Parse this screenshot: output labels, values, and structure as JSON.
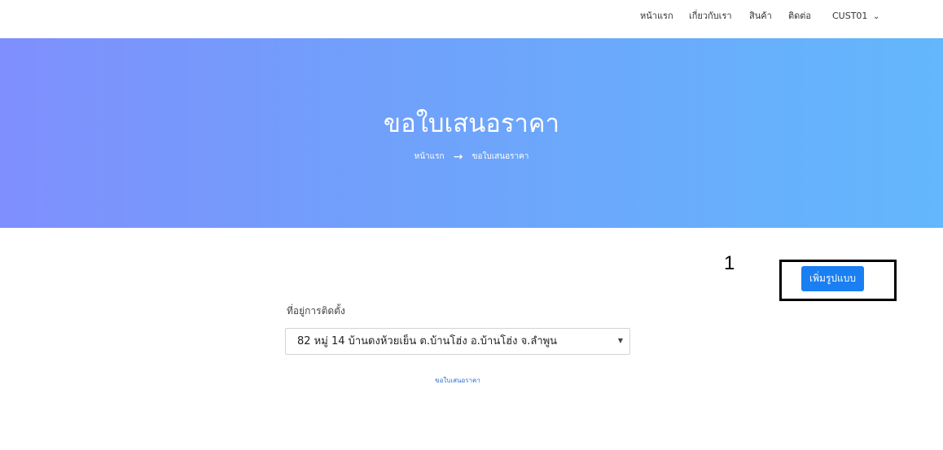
{
  "nav": {
    "home": "หน้าแรก",
    "about": "เกี่ยวกับเรา",
    "products": "สินค้า",
    "contact": "ติดต่อ",
    "user": "CUST01",
    "user_caret": "⌄"
  },
  "hero": {
    "title": "ขอใบเสนอราคา",
    "breadcrumb": {
      "home": "หน้าแรก",
      "arrow": "→",
      "current": "ขอใบเสนอราคา"
    }
  },
  "annotation": {
    "marker": "1"
  },
  "actions": {
    "add_pattern": "เพิ่มรูปแบบ"
  },
  "form": {
    "address_label": "ที่อยู่การติดตั้ง",
    "address_value": "82 หมู่ 14 บ้านดงห้วยเย็น ต.บ้านโฮ่ง อ.บ้านโฮ่ง จ.ลำพูน",
    "caret": "▼",
    "submit_link": "ขอใบเสนอราคา"
  },
  "colors": {
    "hero_start": "#7f8ffd",
    "hero_end": "#63b7fc",
    "button": "#1a7ff2"
  }
}
